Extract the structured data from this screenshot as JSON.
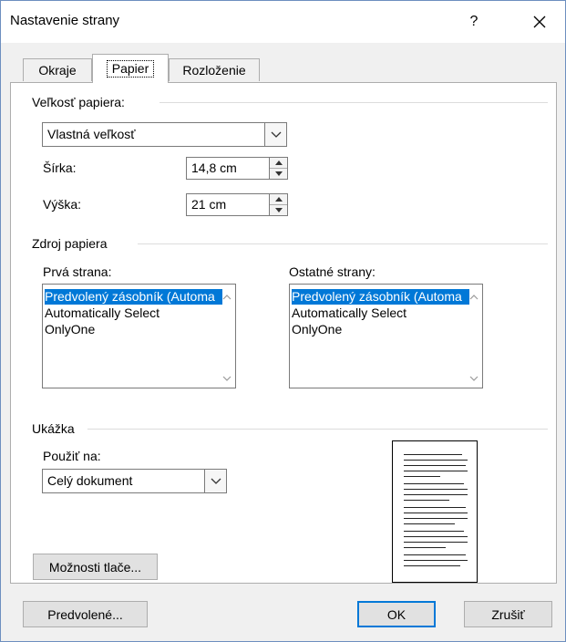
{
  "window": {
    "title": "Nastavenie strany",
    "help_label": "?"
  },
  "tabs": [
    {
      "label": "Okraje",
      "active": false
    },
    {
      "label": "Papier",
      "active": true
    },
    {
      "label": "Rozloženie",
      "active": false
    }
  ],
  "paper_size": {
    "group_label": "Veľkosť papiera:",
    "selected": "Vlastná veľkosť",
    "width_label": "Šírka:",
    "width_value": "14,8 cm",
    "height_label": "Výška:",
    "height_value": "21 cm"
  },
  "paper_source": {
    "group_label": "Zdroj papiera",
    "first_page_label": "Prvá strana:",
    "other_pages_label": "Ostatné strany:",
    "first_page_items": [
      "Predvolený zásobník (Automa",
      "Automatically Select",
      "OnlyOne"
    ],
    "other_pages_items": [
      "Predvolený zásobník (Automa",
      "Automatically Select",
      "OnlyOne"
    ]
  },
  "preview": {
    "group_label": "Ukážka",
    "apply_to_label": "Použiť na:",
    "apply_to_value": "Celý dokument"
  },
  "buttons": {
    "print_options": "Možnosti tlače...",
    "default": "Predvolené...",
    "ok": "OK",
    "cancel": "Zrušiť"
  },
  "colors": {
    "selection": "#0078d7",
    "dialog_bg": "#f0f0f0",
    "panel_bg": "#ffffff"
  }
}
